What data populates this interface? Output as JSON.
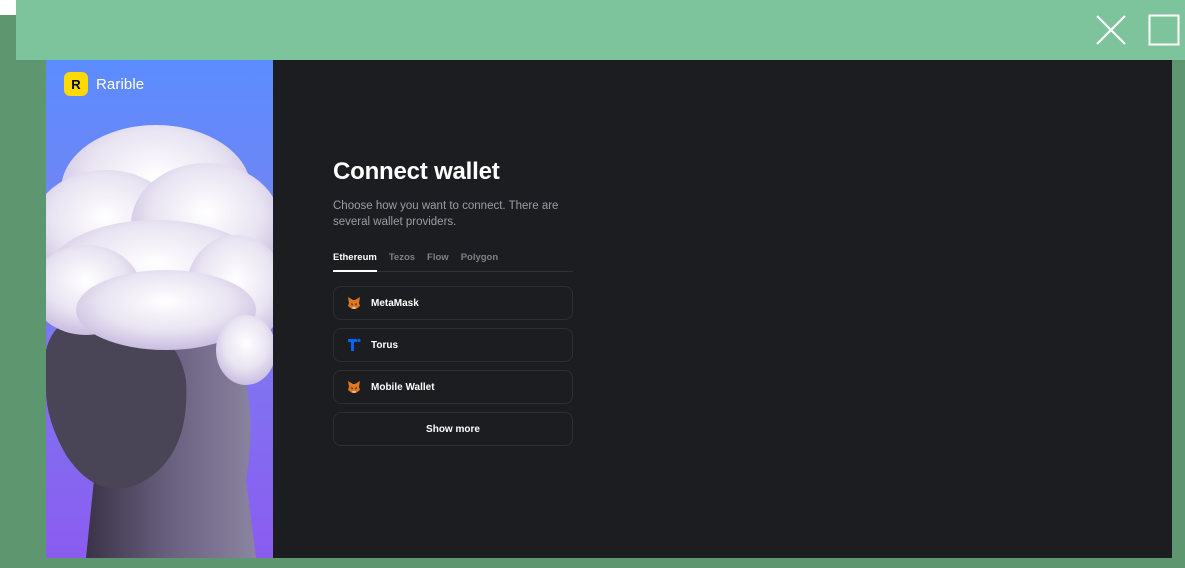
{
  "app": {
    "brand_name": "Rarible",
    "brand_letter": "R",
    "brand_color": "#feda03"
  },
  "window": {
    "controls": [
      "close-icon",
      "maximize-icon"
    ]
  },
  "connect": {
    "title": "Connect wallet",
    "subtitle": "Choose how you want to connect. There are several wallet providers.",
    "tabs": [
      {
        "label": "Ethereum",
        "active": true
      },
      {
        "label": "Tezos",
        "active": false
      },
      {
        "label": "Flow",
        "active": false
      },
      {
        "label": "Polygon",
        "active": false
      }
    ],
    "wallets": [
      {
        "label": "MetaMask",
        "icon": "metamask-fox-icon"
      },
      {
        "label": "Torus",
        "icon": "torus-icon"
      },
      {
        "label": "Mobile Wallet",
        "icon": "metamask-fox-icon"
      }
    ],
    "show_more_label": "Show more"
  },
  "colors": {
    "titlebar": "#7dc39c",
    "frame": "#5e9670",
    "background": "#1b1d20",
    "accent_torus": "#0364ff",
    "accent_metamask": "#e2761b"
  }
}
